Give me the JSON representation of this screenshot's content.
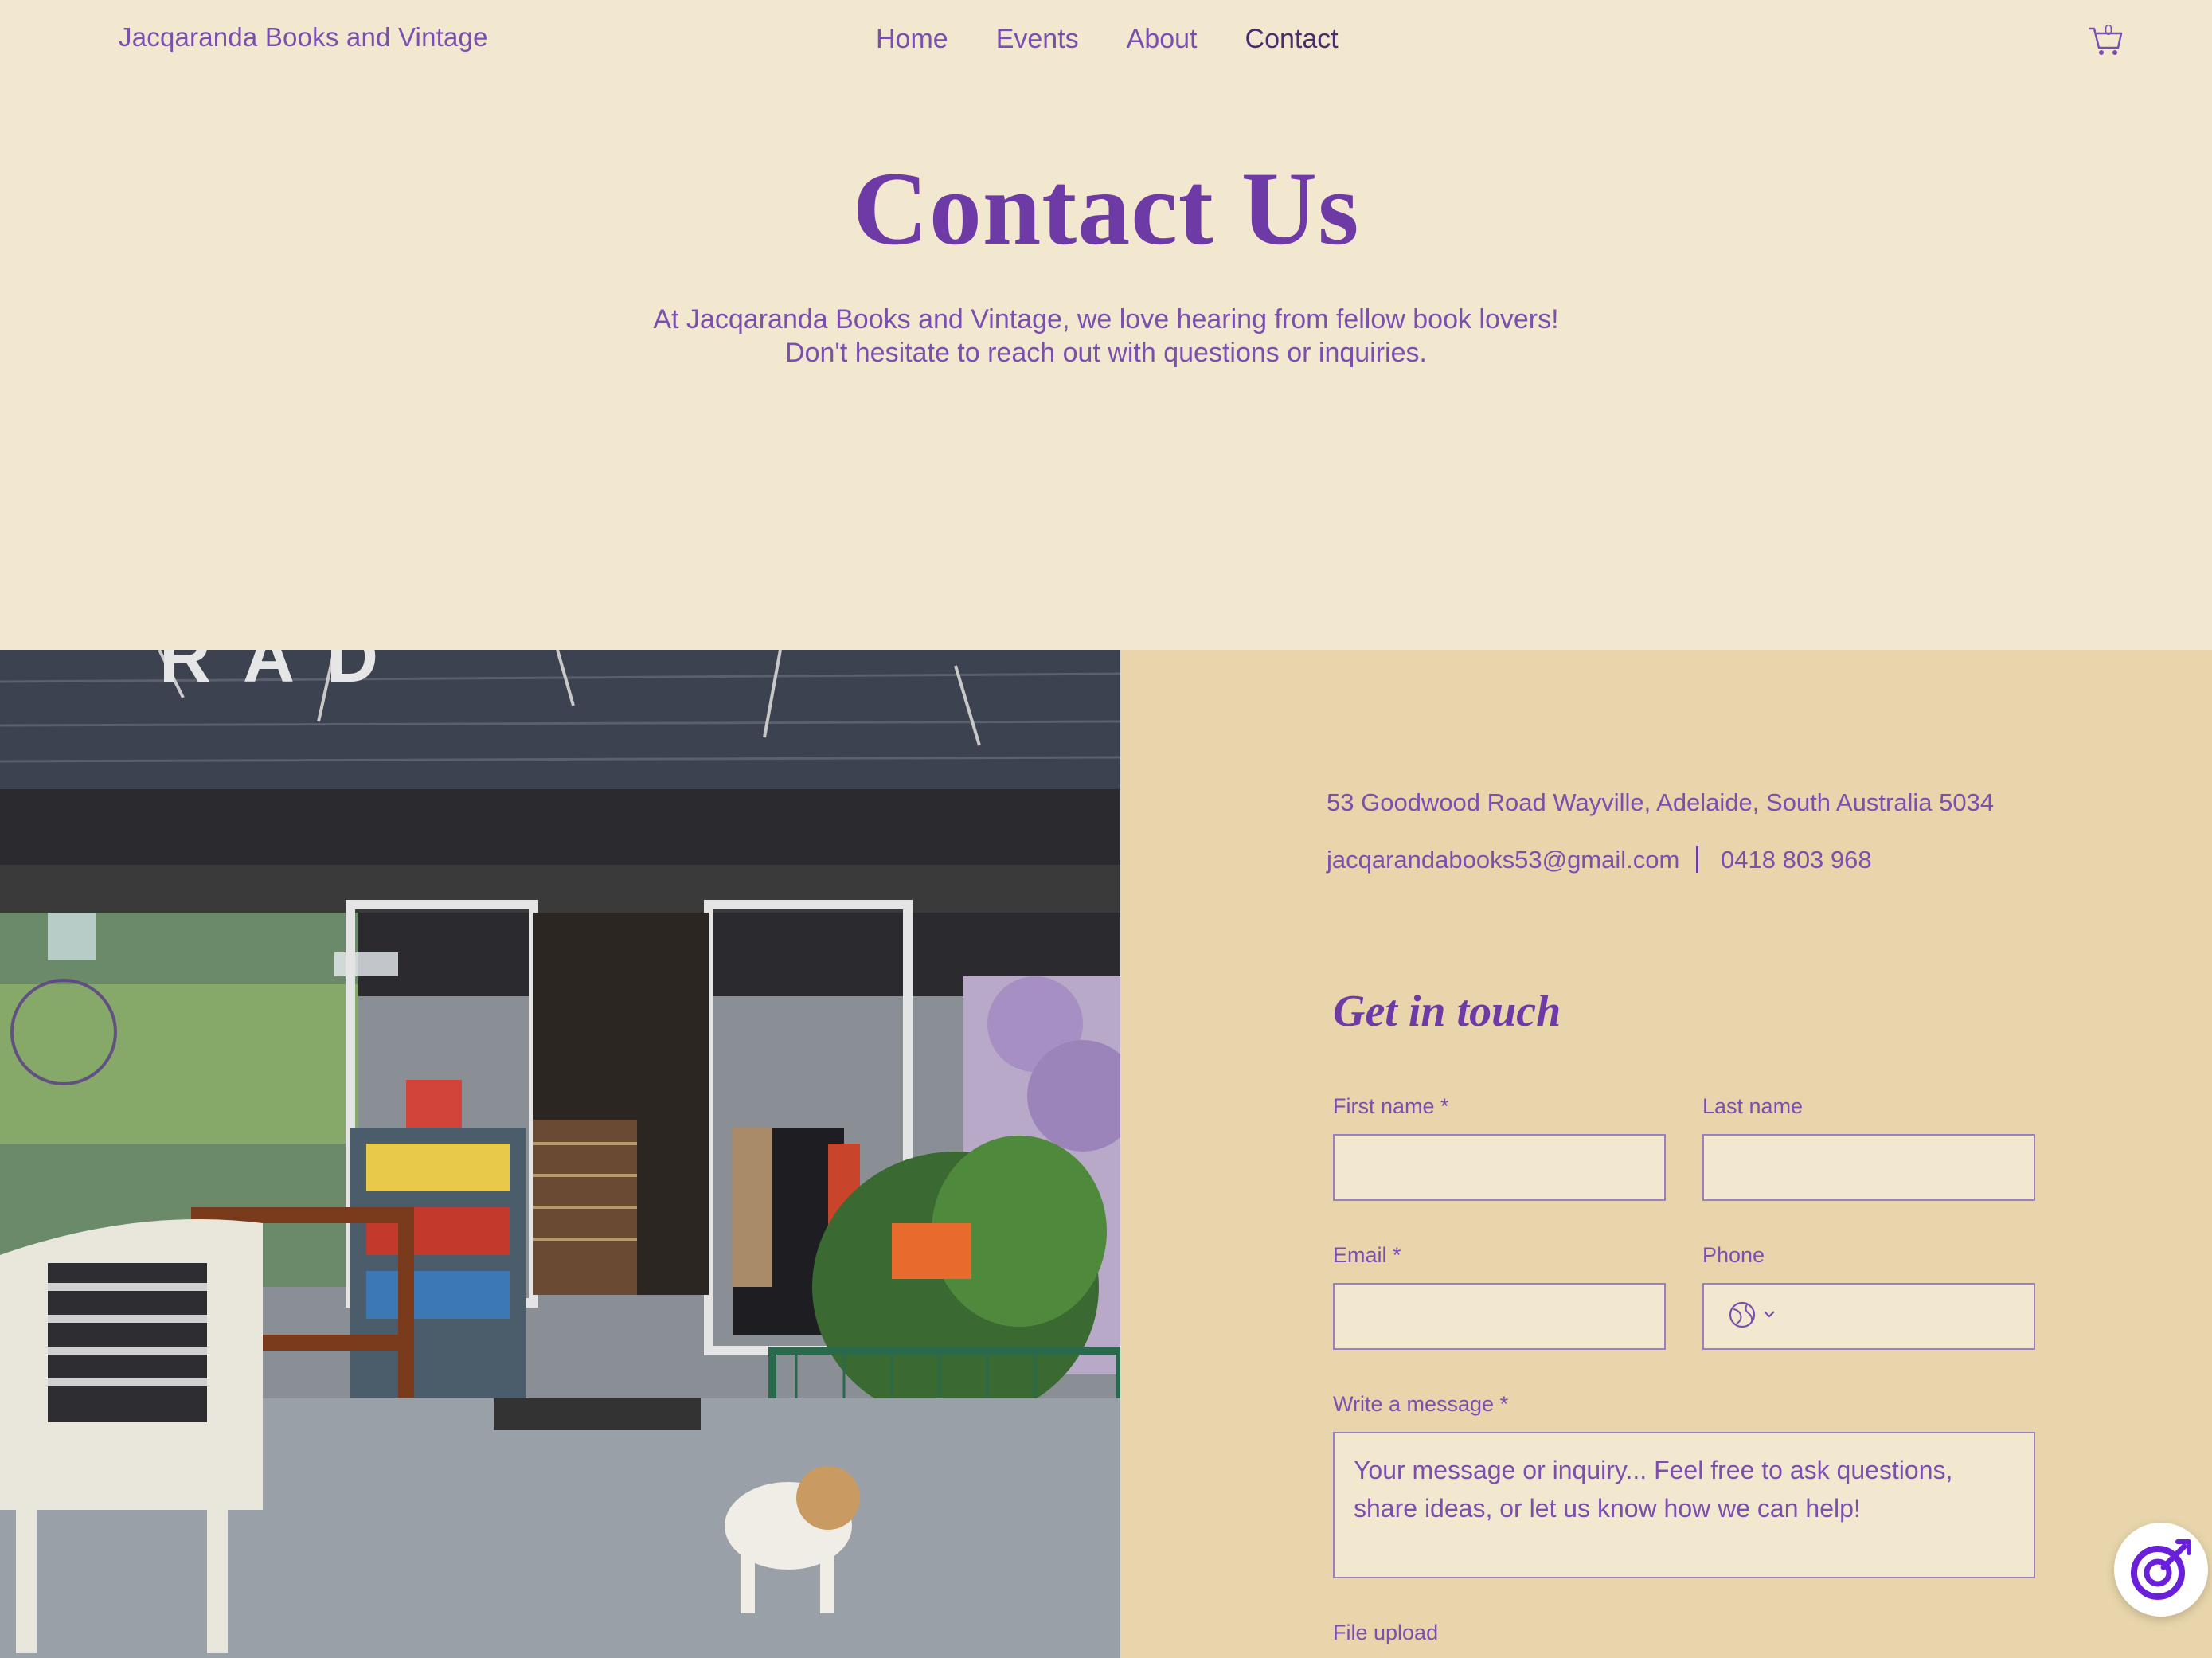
{
  "header": {
    "brand": "Jacqaranda Books and Vintage",
    "nav": [
      {
        "label": "Home"
      },
      {
        "label": "Events"
      },
      {
        "label": "About"
      },
      {
        "label": "Contact"
      }
    ],
    "active_nav": "Contact",
    "cart_count": "0"
  },
  "hero": {
    "title": "Contact Us",
    "intro_line1": "At Jacqaranda Books and Vintage, we love hearing from fellow book lovers!",
    "intro_line2": "Don't hesitate to reach out with questions or inquiries."
  },
  "contact": {
    "address": "53 Goodwood Road Wayville, Adelaide, South Australia 5034",
    "email": "jacqarandabooks53@gmail.com",
    "separator": "|",
    "phone": "0418 803 968"
  },
  "form": {
    "heading": "Get in touch",
    "first_name_label": "First name *",
    "last_name_label": "Last name",
    "email_label": "Email *",
    "phone_label": "Phone",
    "message_label": "Write a message *",
    "message_placeholder": "Your message or inquiry... Feel free to ask questions, share ideas, or let us know how we can help!",
    "file_upload_label": "File upload"
  },
  "colors": {
    "background": "#f2e8cf",
    "panel": "#e8d5ab",
    "accent": "#6e3aa5"
  },
  "icons": {
    "cart": "cart-icon",
    "globe": "globe-icon",
    "chevron": "chevron-down-icon",
    "help": "help-widget-icon"
  }
}
